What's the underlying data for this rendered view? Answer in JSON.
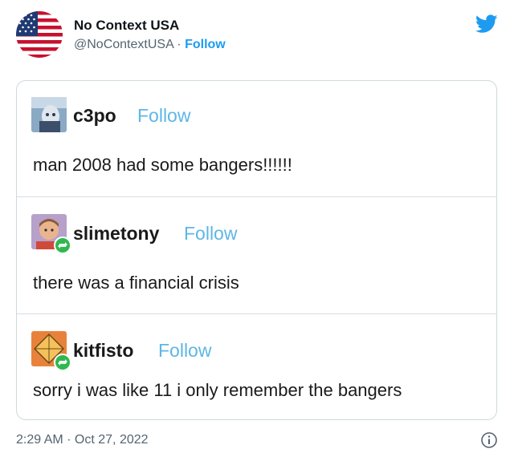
{
  "tweet": {
    "author_name": "No Context USA",
    "author_handle": "@NoContextUSA",
    "separator": " · ",
    "follow_label": "Follow",
    "timestamp": "2:29 AM · Oct 27, 2022",
    "icons": {
      "avatar": "us-flag-avatar",
      "logo": "twitter-bird-icon",
      "info": "info-icon"
    },
    "colors": {
      "twitter_blue": "#1d9bf0",
      "tumblr_follow": "#5eb6e5",
      "reblog_green": "#2fb84f"
    }
  },
  "embed": {
    "posts": [
      {
        "username": "c3po",
        "follow_label": "Follow",
        "text": "man 2008 had some bangers!!!!!!"
      },
      {
        "username": "slimetony",
        "follow_label": "Follow",
        "text": "there was a financial crisis"
      },
      {
        "username": "kitfisto",
        "follow_label": "Follow",
        "text": "sorry i was like 11 i only remember the bangers"
      }
    ]
  }
}
